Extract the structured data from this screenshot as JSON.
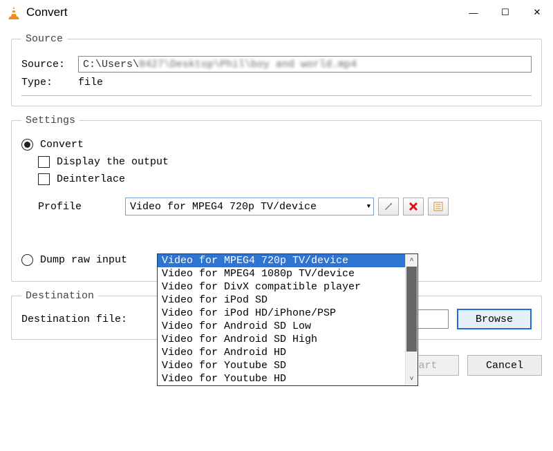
{
  "window": {
    "title": "Convert",
    "minimize_glyph": "—",
    "maximize_glyph": "☐",
    "close_glyph": "✕"
  },
  "source_group": {
    "legend": "Source",
    "source_label": "Source:",
    "source_value_prefix": "C:\\Users\\",
    "source_value_blurred": "0427\\Desktop\\Phil\\boy and world.mp4",
    "type_label": "Type:",
    "type_value": "file"
  },
  "settings_group": {
    "legend": "Settings",
    "convert_label": "Convert",
    "display_output_label": "Display the output",
    "deinterlace_label": "Deinterlace",
    "profile_label": "Profile",
    "profile_selected": "Video for MPEG4 720p TV/device",
    "dump_raw_label": "Dump raw input",
    "options": [
      "Video for MPEG4 720p TV/device",
      "Video for MPEG4 1080p TV/device",
      "Video for DivX compatible player",
      "Video for iPod SD",
      "Video for iPod HD/iPhone/PSP",
      "Video for Android SD Low",
      "Video for Android SD High",
      "Video for Android HD",
      "Video for Youtube SD",
      "Video for Youtube HD"
    ],
    "icons": {
      "wrench": "wrench",
      "delete": "delete",
      "new": "new-profile"
    }
  },
  "destination_group": {
    "legend": "Destination",
    "file_label": "Destination file:",
    "browse_label": "Browse"
  },
  "footer": {
    "start_label": "Start",
    "cancel_label": "Cancel"
  }
}
